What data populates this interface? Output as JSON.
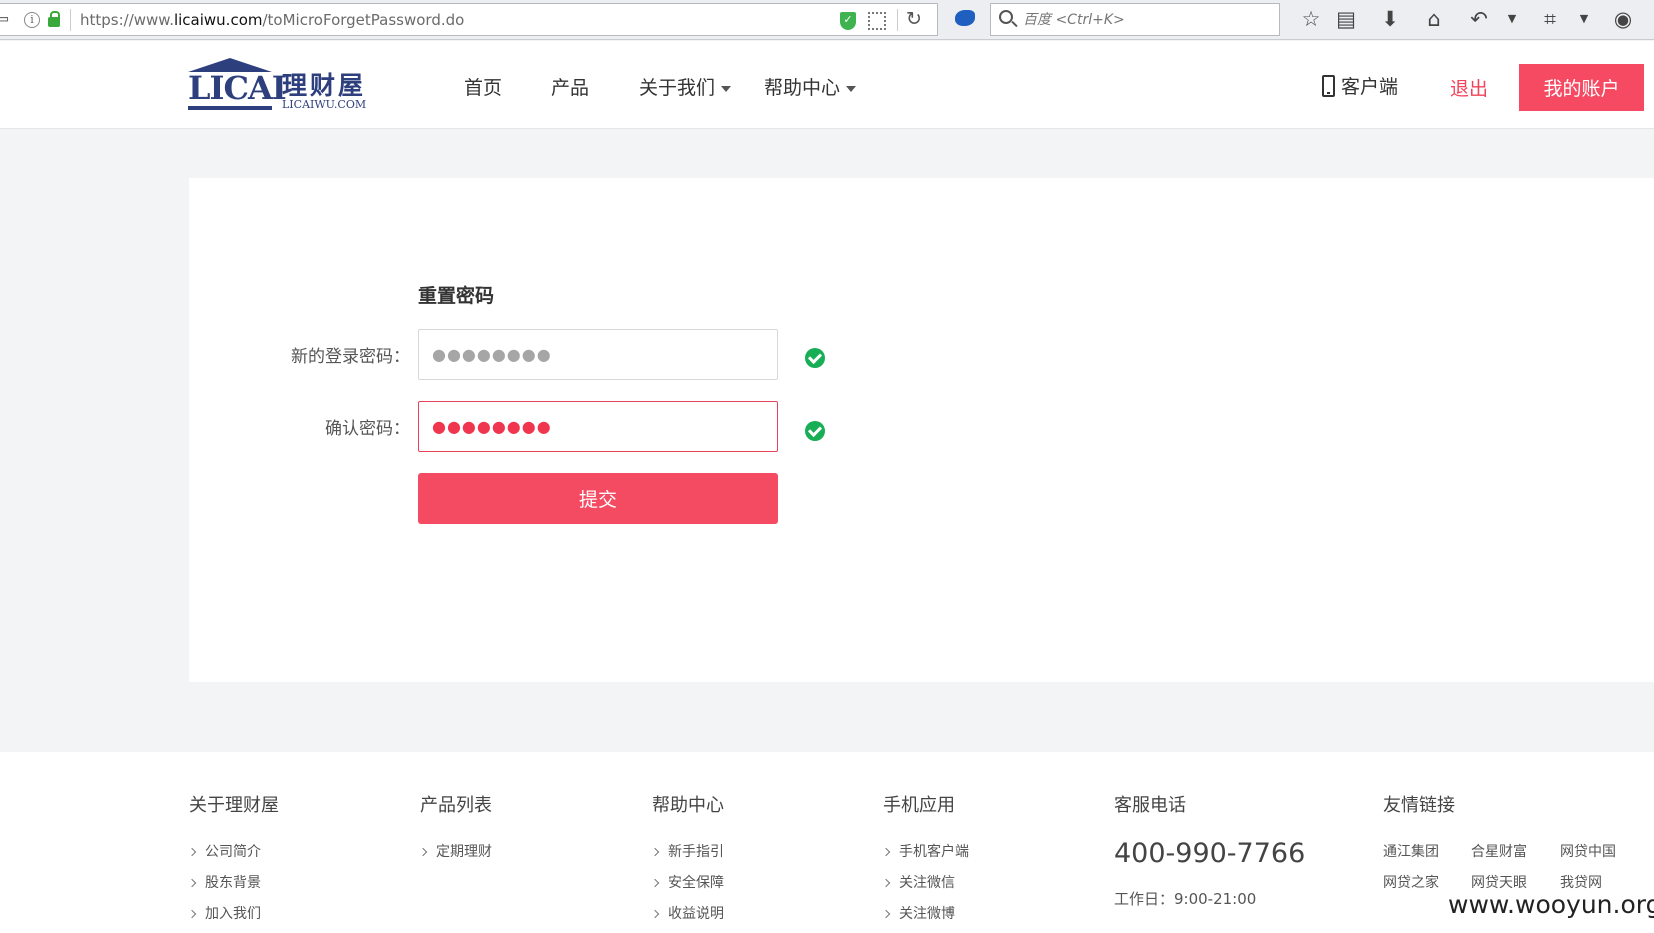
{
  "browser": {
    "url_prefix": "https://www.",
    "url_domain": "licaiwu.com",
    "url_path": "/toMicroForgetPassword.do",
    "search_placeholder": "百度 <Ctrl+K>"
  },
  "header": {
    "logo_text": "LICAI",
    "logo_cn": "理财屋",
    "logo_domain": "LICAIWU.COM",
    "nav": [
      "首页",
      "产品",
      "关于我们",
      "帮助中心"
    ],
    "client_label": "客户端",
    "logout_label": "退出",
    "account_label": "我的账户"
  },
  "form": {
    "title": "重置密码",
    "new_password_label": "新的登录密码：",
    "new_password_mask": "●●●●●●●●",
    "confirm_password_label": "确认密码：",
    "confirm_password_mask": "●●●●●●●●",
    "submit_label": "提交"
  },
  "footer": {
    "about": {
      "title": "关于理财屋",
      "links": [
        "公司简介",
        "股东背景",
        "加入我们"
      ]
    },
    "products": {
      "title": "产品列表",
      "links": [
        "定期理财"
      ]
    },
    "help": {
      "title": "帮助中心",
      "links": [
        "新手指引",
        "安全保障",
        "收益说明"
      ]
    },
    "mobile": {
      "title": "手机应用",
      "links": [
        "手机客户端",
        "关注微信",
        "关注微博"
      ]
    },
    "service": {
      "title": "客服电话",
      "phone": "400-990-7766",
      "hours": "工作日：9:00-21:00"
    },
    "friends": {
      "title": "友情链接",
      "links": [
        "通江集团",
        "合星财富",
        "网贷中国",
        "网贷之家",
        "网贷天眼",
        "我贷网"
      ]
    }
  },
  "watermark": "www.wooyun.org",
  "colors": {
    "accent": "#f64a62",
    "brand": "#2e3f7e",
    "success": "#17ae56"
  }
}
